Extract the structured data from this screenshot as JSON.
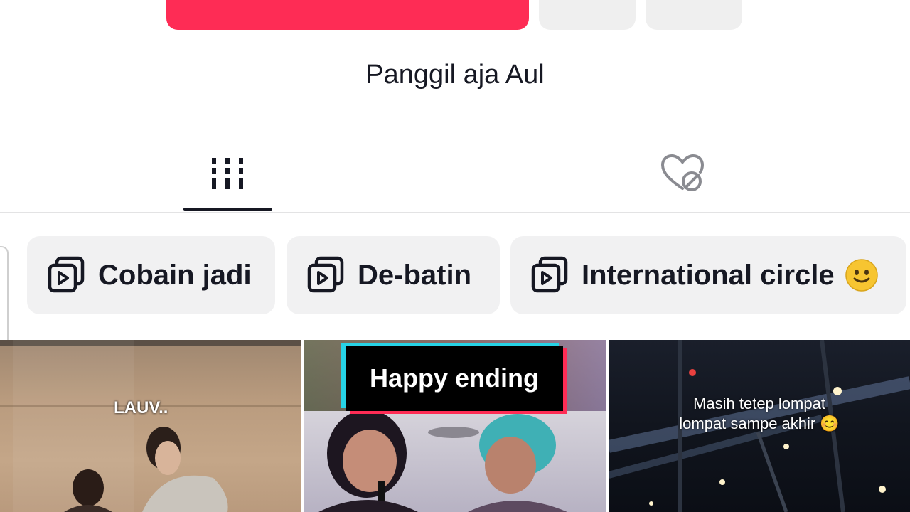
{
  "profile": {
    "bio": "Panggil aja Aul"
  },
  "tabs": [
    {
      "name": "videos",
      "icon": "grid-icon",
      "active": true
    },
    {
      "name": "liked",
      "icon": "heart-hidden-icon",
      "active": false
    }
  ],
  "playlists": [
    {
      "label": "Cobain jadi",
      "icon": "playlist-icon"
    },
    {
      "label": "De-batin",
      "icon": "playlist-icon"
    },
    {
      "label": "International circle",
      "icon": "playlist-icon",
      "emoji": "🙂"
    }
  ],
  "videos": [
    {
      "overlay": "LAUV.."
    },
    {
      "overlay": "Happy ending"
    },
    {
      "overlay_line1": "Masih tetep lompat",
      "overlay_line2": "lompat sampe akhir 😊"
    }
  ],
  "colors": {
    "accent": "#fe2c55",
    "chip_bg": "#f1f1f2",
    "text": "#161823"
  }
}
